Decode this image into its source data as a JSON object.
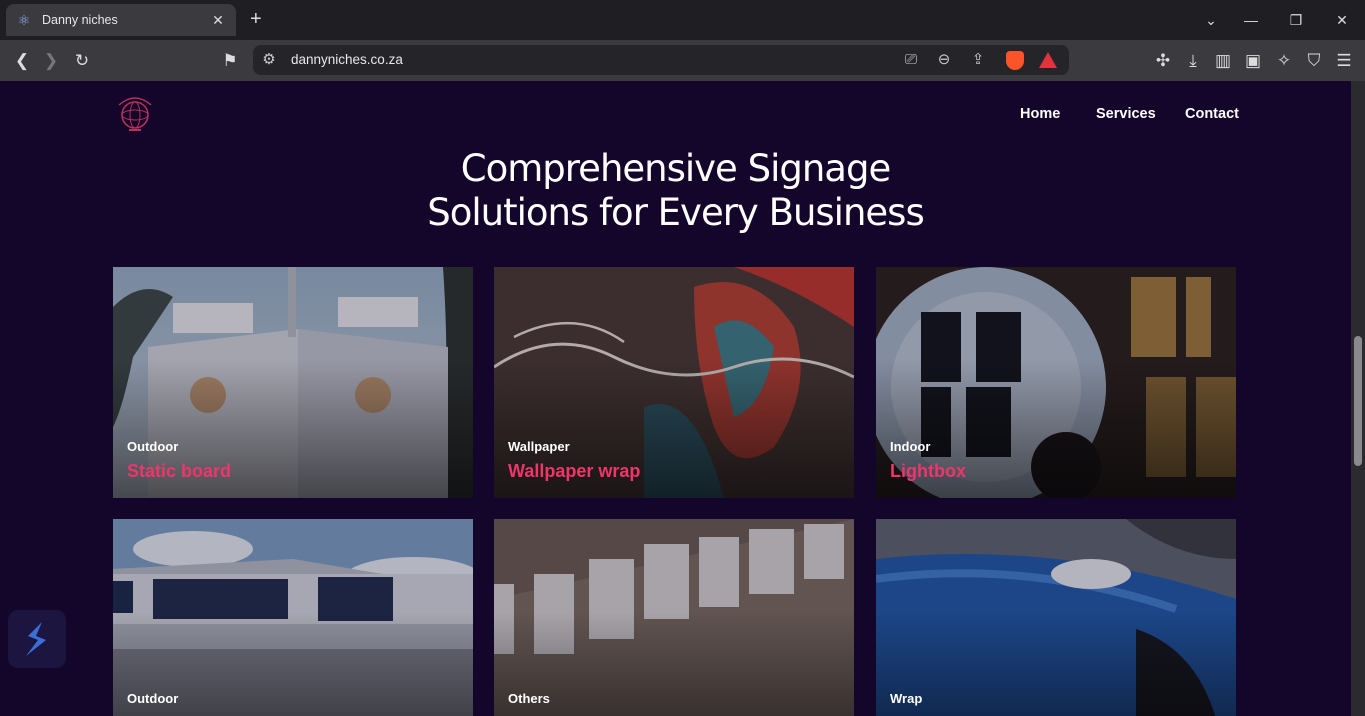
{
  "browser": {
    "tab_title": "Danny niches",
    "url": "dannyniches.co.za",
    "newtab_label": "+",
    "tab_close_label": "✕"
  },
  "site": {
    "nav": [
      "Home",
      "Services",
      "Contact"
    ],
    "headline_line1": "Comprehensive Signage",
    "headline_line2": "Solutions for Every Business"
  },
  "cards": [
    {
      "category": "Outdoor",
      "title": "Static board"
    },
    {
      "category": "Wallpaper",
      "title": "Wallpaper wrap"
    },
    {
      "category": "Indoor",
      "title": "Lightbox"
    },
    {
      "category": "Outdoor",
      "title": ""
    },
    {
      "category": "Others",
      "title": ""
    },
    {
      "category": "Wrap",
      "title": ""
    }
  ],
  "colors": {
    "accent": "#f0356a",
    "page_bg": "#14052a"
  }
}
